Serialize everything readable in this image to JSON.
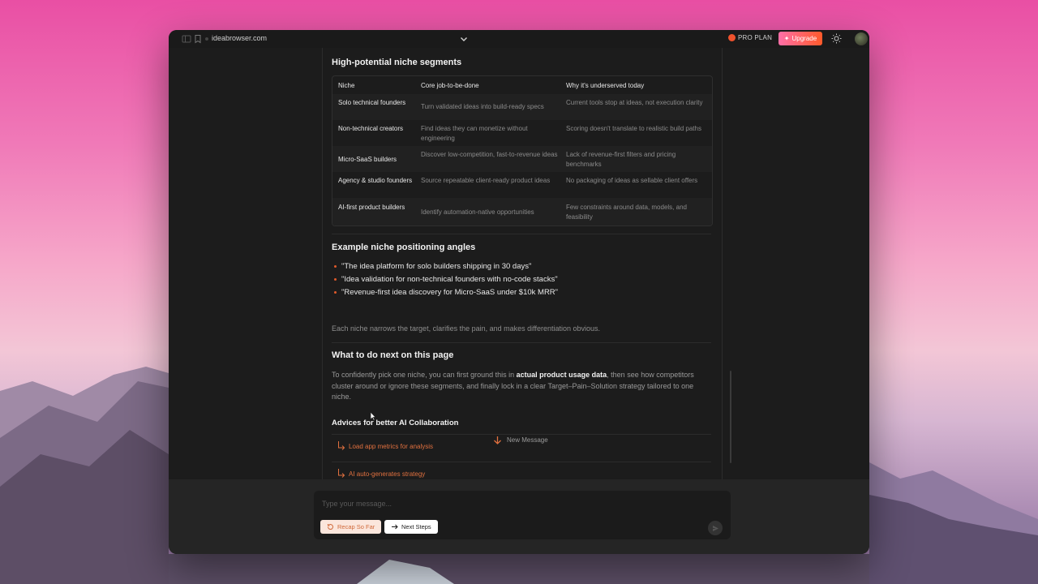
{
  "browser": {
    "url": "ideabrowser.com",
    "pro_plan": "PRO PLAN",
    "upgrade_label": "Upgrade"
  },
  "segments": {
    "title": "High-potential niche segments",
    "headers": [
      "Niche",
      "Core job-to-be-done",
      "Why it's underserved today"
    ],
    "rows": [
      [
        "Solo technical founders",
        "Turn validated ideas into build-ready specs",
        "Current tools stop at ideas, not execution clarity"
      ],
      [
        "Non-technical creators",
        "Find ideas they can monetize without engineering",
        "Scoring doesn't translate to realistic build paths"
      ],
      [
        "Micro-SaaS builders",
        "Discover low-competition, fast-to-revenue ideas",
        "Lack of revenue-first filters and pricing benchmarks"
      ],
      [
        "Agency & studio founders",
        "Source repeatable client-ready product ideas",
        "No packaging of ideas as sellable client offers"
      ],
      [
        "AI-first product builders",
        "Identify automation-native opportunities",
        "Few constraints around data, models, and feasibility"
      ]
    ]
  },
  "angles": {
    "title": "Example niche positioning angles",
    "items": [
      "\"The idea platform for solo builders shipping in 30 days\"",
      "\"Idea validation for non-technical founders with no-code stacks\"",
      "\"Revenue-first idea discovery for Micro-SaaS under $10k MRR\""
    ],
    "summary": "Each niche narrows the target, clarifies the pain, and makes differentiation obvious."
  },
  "next": {
    "title": "What to do next on this page",
    "para_before": "To confidently pick one niche, you can first ground this in ",
    "para_bold": "actual product usage data",
    "para_after": ", then see how competitors cluster around or ignore these segments, and finally lock in a clear Target–Pain–Solution strategy tailored to one niche."
  },
  "advices": {
    "title": "Advices for better AI Collaboration",
    "suggestions": [
      "Load app metrics for analysis",
      "AI auto-generates strategy"
    ],
    "new_message": "New Message"
  },
  "composer": {
    "placeholder": "Type your message...",
    "chip_recap": "Recap So Far",
    "chip_next": "Next Steps"
  },
  "colors": {
    "accent": "#e0703f",
    "upgrade_start": "#ff6fa8",
    "upgrade_end": "#ff5a2a",
    "panel_bg": "#1c1c1c"
  }
}
